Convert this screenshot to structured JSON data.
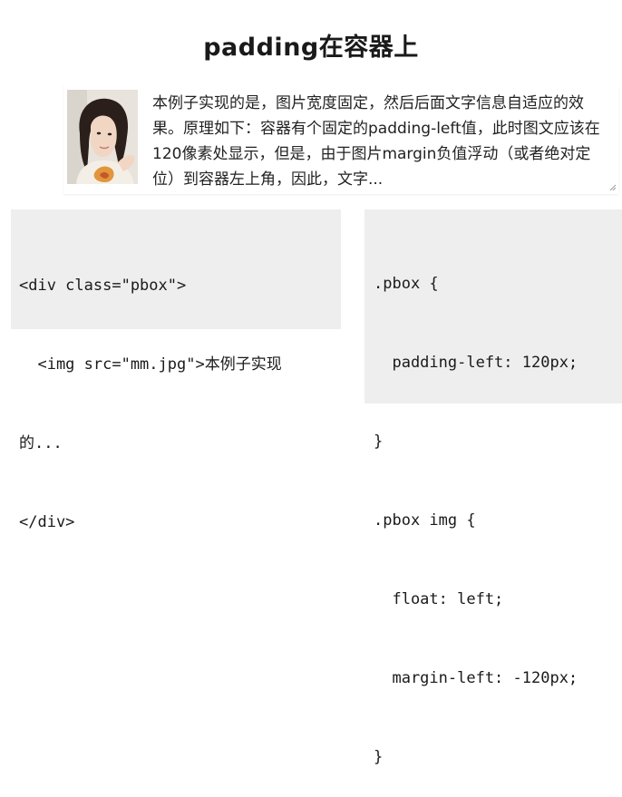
{
  "title": "padding在容器上",
  "demo": {
    "text": "本例子实现的是，图片宽度固定，然后后面文字信息自适应的效果。原理如下：容器有个固定的padding-left值，此时图文应该在120像素处显示，但是，由于图片margin负值浮动（或者绝对定位）到容器左上角，因此，文字..."
  },
  "html_code": {
    "lines": [
      "<div class=\"pbox\">",
      "  <img src=\"mm.jpg\">本例子实现",
      "的...",
      "</div>"
    ]
  },
  "css_code": {
    "lines": [
      ".pbox {",
      "  padding-left: 120px;",
      "}",
      ".pbox img {",
      "  float: left;",
      "  margin-left: -120px;",
      "}"
    ]
  }
}
